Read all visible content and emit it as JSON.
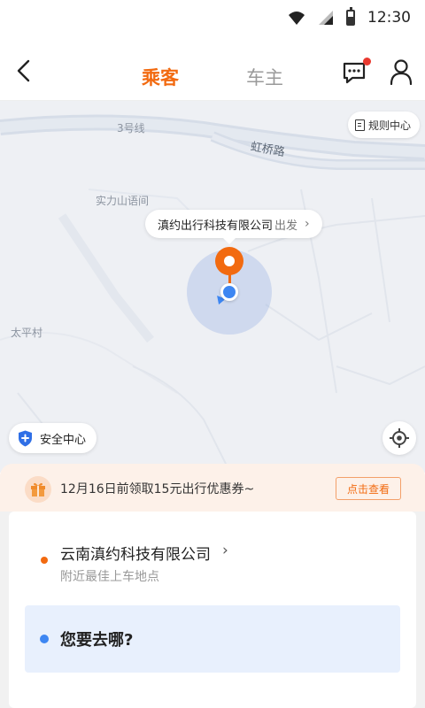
{
  "status_bar": {
    "time": "12:30"
  },
  "header": {
    "tabs": [
      {
        "label": "乘客",
        "active": true
      },
      {
        "label": "车主",
        "active": false
      }
    ],
    "has_unread_message": true
  },
  "map": {
    "labels": {
      "metro_line": "3号线",
      "road": "虹桥路",
      "poi": "实力山语间",
      "village": "太平村"
    },
    "rules_center": "规则中心",
    "pickup_callout": {
      "place": "滇约出行科技有限公司",
      "action": "出发"
    },
    "safety_center": "安全中心"
  },
  "coupon": {
    "text": "12月16日前领取15元出行优惠券~",
    "button": "点击查看"
  },
  "trip": {
    "origin_name": "云南滇约科技有限公司",
    "origin_hint": "附近最佳上车地点",
    "destination_placeholder": "您要去哪?"
  },
  "colors": {
    "accent": "#f26a10",
    "location_blue": "#3d86f2",
    "destination_bg": "#e8f0fd",
    "coupon_bg": "#fdf1e9",
    "map_bg": "#eef0f4"
  }
}
